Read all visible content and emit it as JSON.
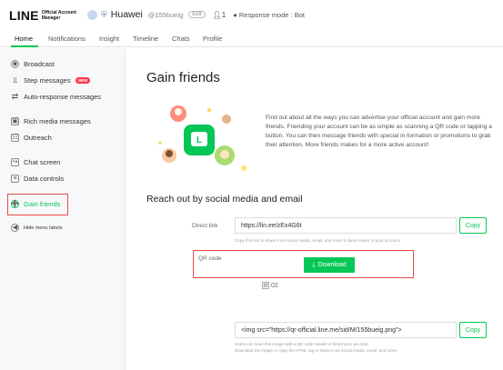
{
  "header": {
    "logo_main": "LINE",
    "logo_sub_line1": "Official Account",
    "logo_sub_line2": "Manager",
    "account_name": "Huawei",
    "account_id": "@155bueig",
    "plan_tag": "Edit",
    "members": "1",
    "response_mode": "Response mode : Bot"
  },
  "tabs": [
    "Home",
    "Notifications",
    "Insight",
    "Timeline",
    "Chats",
    "Profile"
  ],
  "sidebar": {
    "items": [
      {
        "label": "Broadcast",
        "icon": "broadcast-icon"
      },
      {
        "label": "Step messages",
        "icon": "step-messages-icon",
        "badge": "NEW"
      },
      {
        "label": "Auto-response messages",
        "icon": "auto-response-icon"
      },
      {
        "label": "Rich media messages",
        "icon": "rich-media-icon"
      },
      {
        "label": "Outreach",
        "icon": "outreach-icon"
      },
      {
        "label": "Chat screen",
        "icon": "chat-screen-icon"
      },
      {
        "label": "Data controls",
        "icon": "data-controls-icon"
      },
      {
        "label": "Gain friends",
        "icon": "gain-friends-icon",
        "active": true
      },
      {
        "label": "Hide menu labels",
        "icon": "hide-labels-icon"
      }
    ]
  },
  "main": {
    "title": "Gain friends",
    "intro": "Find out about all the ways you can advertise your official account and gain more friends. Friending your account can be as simple as scanning a QR code or tapping a button. You can then message friends with special in-formation or promotions to grab their attention. More friends makes for a more active account!",
    "section_title": "Reach out by social media and email",
    "direct_link": {
      "label": "Direct link",
      "value": "https://lin.ee/zEx4G6t",
      "copy_label": "Copy",
      "hint": "Copy this link to share it via social media, email, and more to direct users to your account."
    },
    "qr_code": {
      "label": "QR code",
      "download_label": "Download",
      "image_alt": "02"
    },
    "embed": {
      "value": "<img src=\"https://qr-official.line.me/sid/M/155bueig.png\">",
      "copy_label": "Copy",
      "hint_line1": "Users can scan this image with a QR code reader to friend your account.",
      "hint_line2": "Download the image or copy the HTML tag to share it via social media, email, and more."
    }
  },
  "colors": {
    "accent": "#06c755",
    "highlight": "#e84a4a",
    "sidebar_bg": "#f7f8fa"
  }
}
